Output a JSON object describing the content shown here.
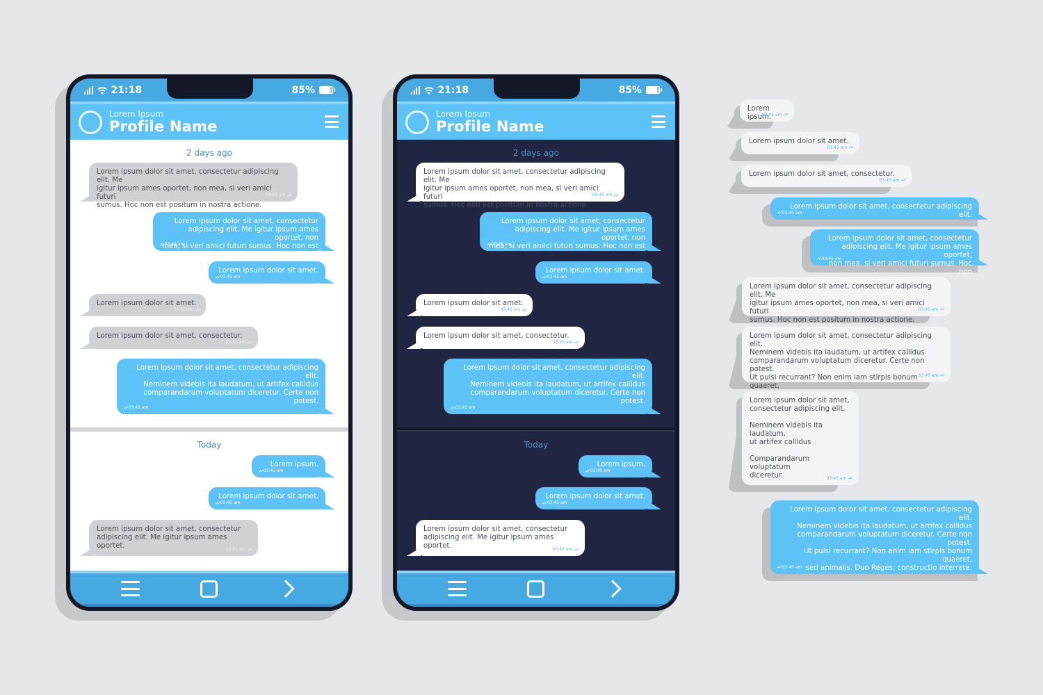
{
  "colors": {
    "background": "#e6e7ea",
    "accent_blue": "#5dc2f6",
    "bar_blue": "#47a9e2",
    "dark_chat_bg": "#212541",
    "light_chat_bg": "#ffffff",
    "incoming_light": "#d0d1d4",
    "incoming_dark": "#ffffff"
  },
  "phones": [
    {
      "theme": "light",
      "status": {
        "time": "21:18",
        "battery": "85%",
        "signal_icon": "signal-icon",
        "wifi_icon": "wifi-icon",
        "battery_icon": "battery-icon"
      },
      "header": {
        "subtitle": "Lorem Ipsum",
        "title": "Profile Name",
        "menu_icon": "menu-icon"
      },
      "sections": [
        {
          "date_label": "2 days ago",
          "messages": [
            {
              "dir": "in",
              "text": "Lorem ipsum dolor sit amet, consectetur adipiscing elit. Me\nigitur ipsum ames oportet, non mea, si veri amici futuri\nsumus. Hoc non est positum in nostra actione.",
              "time": "03:45 am"
            },
            {
              "dir": "out",
              "text": "Lorem ipsum dolor sit amet, consectetur\nadipiscing elit. Me igitur ipsum ames oportet, non\nmea, si veri amici futuri sumus. Hoc non est",
              "time": "03:45 am"
            },
            {
              "dir": "out",
              "text": "Lorem ipsum dolor sit amet.",
              "time": "03:45 am"
            },
            {
              "dir": "in",
              "text": "Lorem ipsum dolor sit amet.",
              "time": "03:45 am"
            },
            {
              "dir": "in",
              "text": "Lorem ipsum dolor sit amet, consectetur.",
              "time": "03:45 am"
            },
            {
              "dir": "out",
              "text": "Lorem ipsum dolor sit amet, consectetur adipiscing elit.\nNeminem videbis ita laudatum, ut artifex callidus\ncomparandarum voluptatum diceretur. Certe non potest.",
              "time": "03:45 am"
            }
          ]
        },
        {
          "date_label": "Today",
          "messages": [
            {
              "dir": "out",
              "text": "Lorem ipsum.",
              "time": "03:45 am"
            },
            {
              "dir": "out",
              "text": "Lorem ipsum dolor sit amet.",
              "time": "03:45 am"
            },
            {
              "dir": "in",
              "text": "Lorem ipsum dolor sit amet, consectetur\nadipiscing elit. Me igitur ipsum ames oportet.",
              "time": "03:45 am"
            }
          ]
        }
      ],
      "nav": [
        {
          "icon": "nav-menu-icon",
          "label": "Menu"
        },
        {
          "icon": "nav-home-icon",
          "label": "Home"
        },
        {
          "icon": "nav-next-icon",
          "label": "Next"
        }
      ]
    },
    {
      "theme": "dark",
      "status": {
        "time": "21:18",
        "battery": "85%",
        "signal_icon": "signal-icon",
        "wifi_icon": "wifi-icon",
        "battery_icon": "battery-icon"
      },
      "header": {
        "subtitle": "Lorem Ipsum",
        "title": "Profile Name",
        "menu_icon": "menu-icon"
      },
      "sections": [
        {
          "date_label": "2 days ago",
          "messages": [
            {
              "dir": "in",
              "text": "Lorem ipsum dolor sit amet, consectetur adipiscing elit. Me\nigitur ipsum ames oportet, non mea, si veri amici futuri\nsumus. Hoc non est positum in nostra actione.",
              "time": "03:45 am"
            },
            {
              "dir": "out",
              "text": "Lorem ipsum dolor sit amet, consectetur\nadipiscing elit. Me igitur ipsum ames oportet, non\nmea, si veri amici futuri sumus. Hoc non est",
              "time": "03:45 am"
            },
            {
              "dir": "out",
              "text": "Lorem ipsum dolor sit amet.",
              "time": "03:45 am"
            },
            {
              "dir": "in",
              "text": "Lorem ipsum dolor sit amet.",
              "time": "03:45 am"
            },
            {
              "dir": "in",
              "text": "Lorem ipsum dolor sit amet, consectetur.",
              "time": "03:45 am"
            },
            {
              "dir": "out",
              "text": "Lorem ipsum dolor sit amet, consectetur adipiscing elit.\nNeminem videbis ita laudatum, ut artifex callidus\ncomparandarum voluptatum diceretur. Certe non potest.",
              "time": "03:45 am"
            }
          ]
        },
        {
          "date_label": "Today",
          "messages": [
            {
              "dir": "out",
              "text": "Lorem ipsum.",
              "time": "03:45 am"
            },
            {
              "dir": "out",
              "text": "Lorem ipsum dolor sit amet.",
              "time": "03:45 am"
            },
            {
              "dir": "in",
              "text": "Lorem ipsum dolor sit amet, consectetur\nadipiscing elit. Me igitur ipsum ames oportet.",
              "time": "03:45 am"
            }
          ]
        }
      ],
      "nav": [
        {
          "icon": "nav-menu-icon",
          "label": "Menu"
        },
        {
          "icon": "nav-home-icon",
          "label": "Home"
        },
        {
          "icon": "nav-next-icon",
          "label": "Next"
        }
      ]
    }
  ],
  "loose_bubbles": [
    {
      "dir": "in",
      "text": "Lorem ipsum.",
      "time": "03:45 am"
    },
    {
      "dir": "in",
      "text": "Lorem ipsum dolor sit amet.",
      "time": "03:45 am"
    },
    {
      "dir": "in",
      "text": "Lorem ipsum dolor sit amet, consectetur.",
      "time": "03:45 am"
    },
    {
      "dir": "out",
      "text": "Lorem ipsum dolor sit amet, consectetur adipiscing elit.",
      "time": "03:45 am"
    },
    {
      "dir": "out",
      "text": "Lorem ipsum dolor sit amet, consectetur\nadipiscing elit. Me igitur ipsum ames oportet,\nnon mea, si veri amici futuri sumus. Hoc non",
      "time": "03:45 am"
    },
    {
      "dir": "in",
      "text": "Lorem ipsum dolor sit amet, consectetur adipiscing elit. Me\nigitur ipsum ames oportet, non mea, si veri amici futuri\nsumus. Hoc non est positum in nostra actione.",
      "time": "03:45 am"
    },
    {
      "dir": "in",
      "text": "Lorem ipsum dolor sit amet, consectetur adipiscing elit.\nNeminem videbis ita laudatum, ut artifex callidus\ncomparandarum voluptatum diceretur. Certe non potest.\nUt pulsi recurrant? Non enim iam stirpis bonum quaeret,",
      "time": "03:45 am"
    },
    {
      "dir": "in",
      "text": "Lorem ipsum dolor sit amet,\nconsectetur adipiscing elit.\n\nNeminem videbis ita laudatum,\nut artifex callidus\n\nComparandarum voluptatum\ndiceretur.",
      "time": "03:45 am"
    },
    {
      "dir": "out",
      "text": "Lorem ipsum dolor sit amet, consectetur adipiscing elit.\nNeminem videbis ita laudatum, ut artifex callidus\ncomparandarum voluptatum diceretur. Certe non potest.\nUt pulsi recurrant? Non enim iam stirpis bonum quaeret,\nsed animalis. Duo Reges: constructio interrete.",
      "time": "03:45 am"
    }
  ]
}
